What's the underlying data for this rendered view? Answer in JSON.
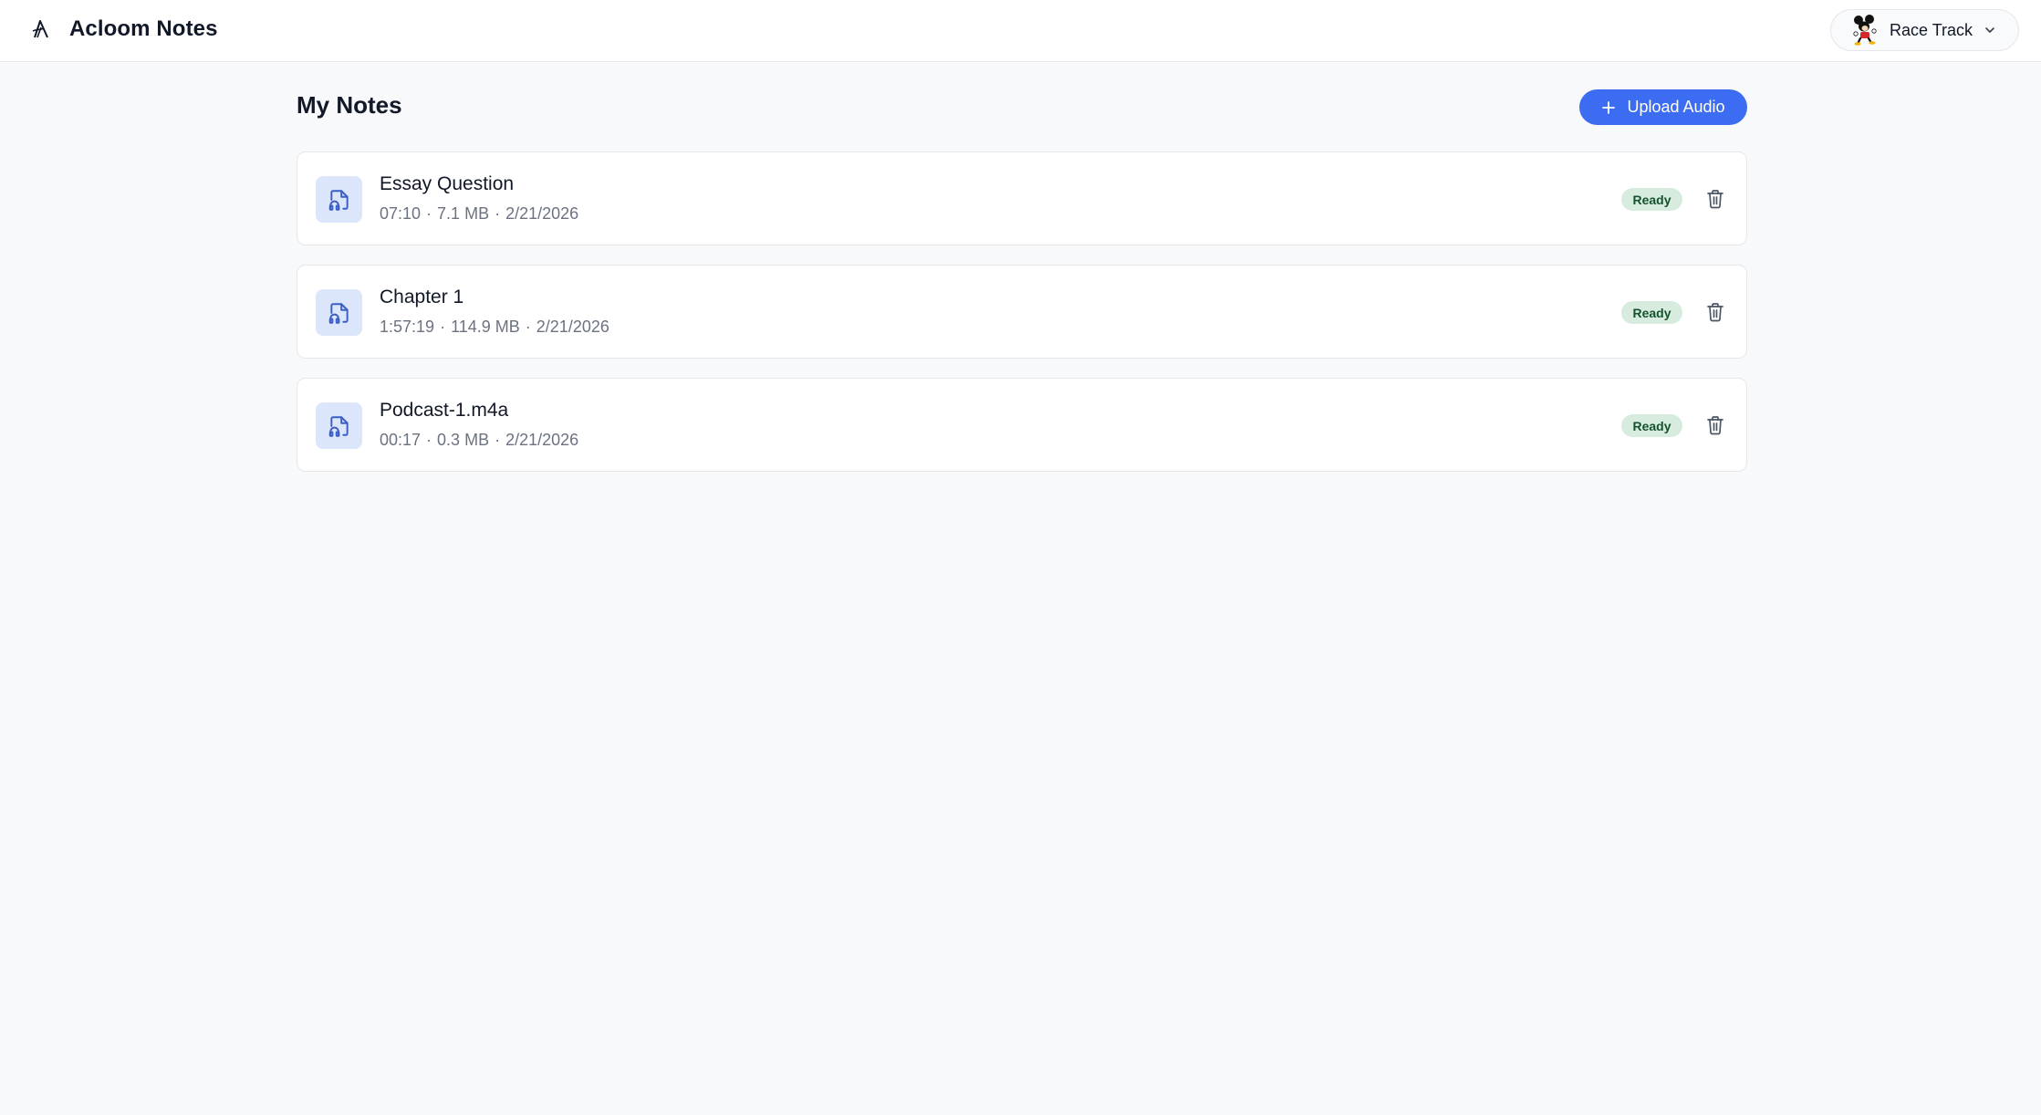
{
  "app": {
    "title": "Acloom Notes",
    "logo_icon": "acloom-logo-icon"
  },
  "account": {
    "name": "Race Track",
    "avatar_icon": "mouse-character-avatar",
    "dropdown_icon": "chevron-down-icon"
  },
  "page": {
    "title": "My Notes",
    "upload_label": "Upload Audio",
    "upload_icon": "plus-icon"
  },
  "notes": [
    {
      "title": "Essay Question",
      "duration": "07:10",
      "size": "7.1 MB",
      "date": "2/21/2026",
      "status": "Ready",
      "icon": "audio-file-icon"
    },
    {
      "title": "Chapter 1",
      "duration": "1:57:19",
      "size": "114.9 MB",
      "date": "2/21/2026",
      "status": "Ready",
      "icon": "audio-file-icon"
    },
    {
      "title": "Podcast-1.m4a",
      "duration": "00:17",
      "size": "0.3 MB",
      "date": "2/21/2026",
      "status": "Ready",
      "icon": "audio-file-icon"
    }
  ],
  "meta_separator": "·",
  "colors": {
    "accent": "#3b6cf2",
    "status_bg": "#d7ebdf",
    "status_text": "#14532d",
    "icon_bg": "#dbe6fb",
    "icon_fg": "#3b5fc4",
    "page_bg": "#f8f9fb"
  }
}
